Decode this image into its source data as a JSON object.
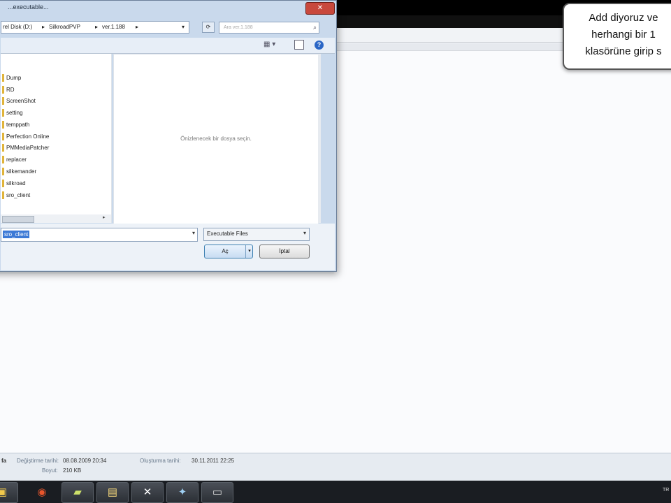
{
  "callout": {
    "text": "Add diyoruz ve\nherhangi bir 1\nklasörüne girip s"
  },
  "dialog": {
    "title": "...executable...",
    "close_icon": "close-icon",
    "breadcrumb": [
      "rel Disk (D:)",
      "SilkroadPVP",
      "ver.1.188"
    ],
    "search_placeholder": "Ara ver.1.188",
    "nav_items": [
      "Dump",
      "RD",
      "ScreenShot",
      "setting",
      "temppath",
      "Perfection Online",
      "PMMediaPatcher",
      "replacer",
      "silkemander",
      "silkroad",
      "sro_client"
    ],
    "preview_text": "Önizlenecek bir dosya seçin.",
    "filename_value": "sro_client",
    "filetype_value": "Executable Files",
    "open_label": "Aç",
    "cancel_label": "İptal"
  },
  "details": {
    "type_label": "fa",
    "modified_label": "Değiştirme tarihi:",
    "modified_value": "08.08.2009 20:34",
    "created_label": "Oluşturma tarihi:",
    "created_value": "30.11.2011 22:25",
    "size_label": "Boyut:",
    "size_value": "210 KB"
  },
  "taskbar": {
    "items": [
      "explorer-icon",
      "browser-icon",
      "notes-icon",
      "folder-icon",
      "pdf-icon",
      "bird-icon",
      "window-icon"
    ],
    "clock_text": "TR"
  }
}
